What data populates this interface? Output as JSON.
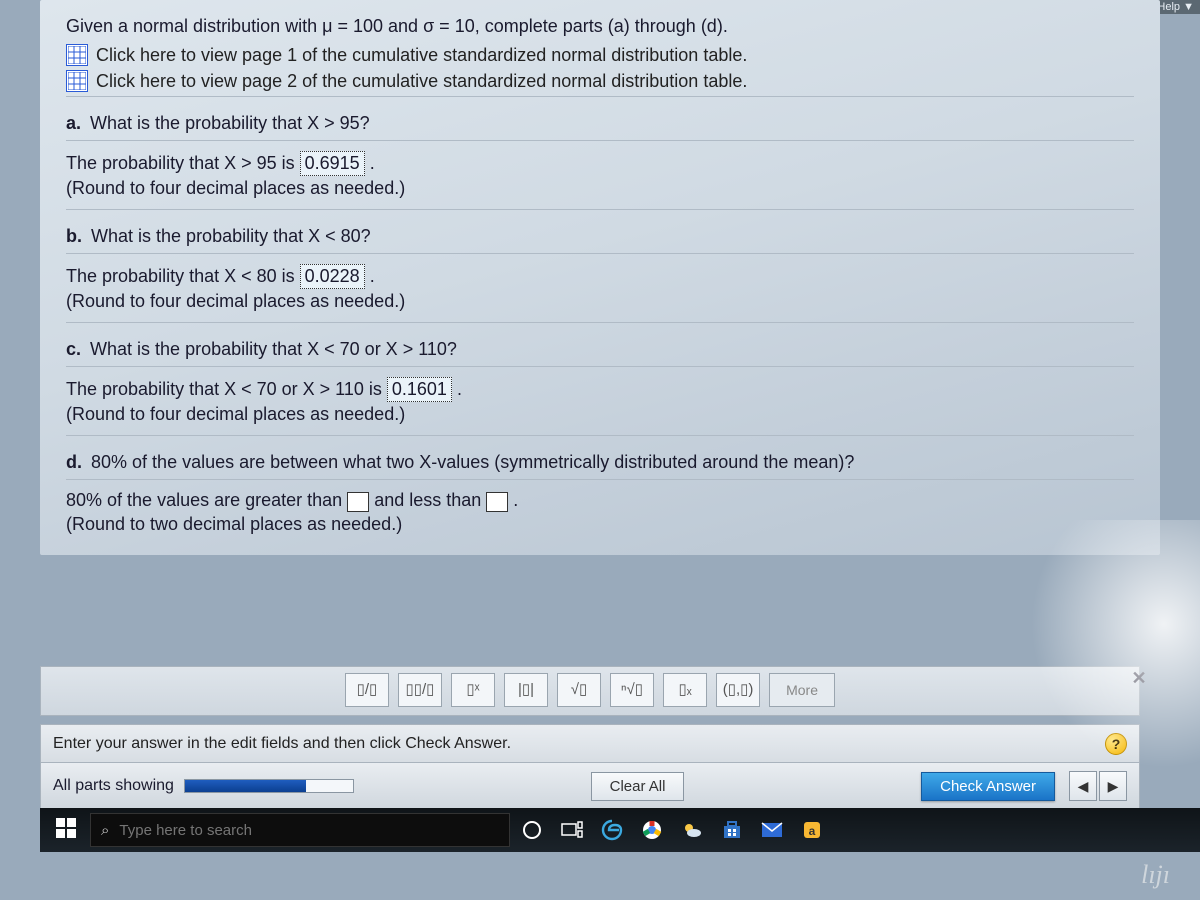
{
  "header_fragment": "Question Help ▼",
  "prompt": "Given a normal distribution with μ = 100 and σ = 10, complete parts (a) through (d).",
  "links": {
    "page1": "Click here to view page 1 of the cumulative standardized normal distribution table.",
    "page2": "Click here to view page 2 of the cumulative standardized normal distribution table."
  },
  "parts": {
    "a": {
      "label": "a.",
      "question": "What is the probability that X > 95?",
      "answer_prefix": "The probability that X > 95 is ",
      "answer_value": "0.6915",
      "answer_suffix": " .",
      "hint": "(Round to four decimal places as needed.)"
    },
    "b": {
      "label": "b.",
      "question": "What is the probability that X < 80?",
      "answer_prefix": "The probability that X < 80 is ",
      "answer_value": "0.0228",
      "answer_suffix": " .",
      "hint": "(Round to four decimal places as needed.)"
    },
    "c": {
      "label": "c.",
      "question": "What is the probability that X < 70 or X > 110?",
      "answer_prefix": "The probability that X < 70 or X > 110 is ",
      "answer_value": "0.1601",
      "answer_suffix": " .",
      "hint": "(Round to four decimal places as needed.)"
    },
    "d": {
      "label": "d.",
      "question": "80% of the values are between what two X-values (symmetrically distributed around the mean)?",
      "fill_prefix": "80% of the values are greater than ",
      "fill_mid": " and less than ",
      "fill_suffix": ".",
      "hint": "(Round to two decimal places as needed.)"
    }
  },
  "palette": {
    "frac": "▯/▯",
    "mixed": "▯▯/▯",
    "exp": "▯ˣ",
    "abs": "|▯|",
    "sqrt": "√▯",
    "nroot": "ⁿ√▯",
    "sub": "▯ₓ",
    "tuple": "(▯,▯)",
    "more": "More"
  },
  "instruction": "Enter your answer in the edit fields and then click Check Answer.",
  "help_symbol": "?",
  "controls": {
    "parts_label": "All parts showing",
    "clear": "Clear All",
    "check": "Check Answer",
    "prev": "◀",
    "next": "▶"
  },
  "close_x": "✕",
  "taskbar": {
    "search_placeholder": "Type here to search"
  },
  "signature": "lıjı"
}
